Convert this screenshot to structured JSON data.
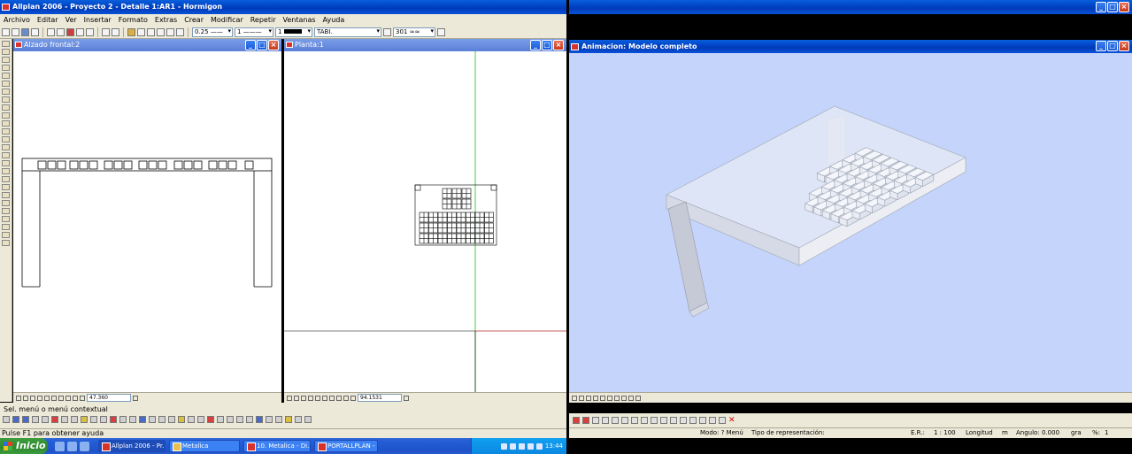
{
  "app": {
    "title": "Allplan 2006 - Proyecto 2 - Detalle 1:AR1 - Hormigon",
    "menu": [
      "Archivo",
      "Editar",
      "Ver",
      "Insertar",
      "Formato",
      "Extras",
      "Crear",
      "Modificar",
      "Repetir",
      "Ventanas",
      "Ayuda"
    ],
    "toolbar": {
      "pen_thickness": "0.25",
      "line_type": "1",
      "line_color": "1",
      "layer": "TABI.",
      "pattern": "301"
    }
  },
  "viewports": {
    "front": {
      "title": "Alzado frontal:2",
      "coord_field": "47.360"
    },
    "plan": {
      "title": "Planta:1",
      "coord_field": "94.1531"
    },
    "animation": {
      "title": "Animacion: Modelo completo"
    }
  },
  "hints": {
    "context": "Sel. menú o menú contextual",
    "help": "Pulse F1 para obtener ayuda"
  },
  "status_right": {
    "mode": "Modo: ? Menú",
    "representation": "Tipo de representación:",
    "scale_label": "E.R.:",
    "scale_value": "1 : 100",
    "length_label": "Longitud",
    "length_unit": "m",
    "angle_label": "Angulo:",
    "angle_value": "0.000",
    "angle_unit": "gra",
    "percent_label": "%:",
    "percent_value": "1"
  },
  "taskbar": {
    "start_label": "Inicio",
    "tasks": [
      "Allplan 2006 - Pr...",
      "Metalica",
      "10. Metalica - Di...",
      "PORTALLPLAN - ..."
    ],
    "clock": "13:44"
  },
  "colors": {
    "anim_background": "#c4d4fb",
    "xp_title": "#0045c8",
    "axis_green": "#46d246",
    "axis_red": "#e05050"
  }
}
